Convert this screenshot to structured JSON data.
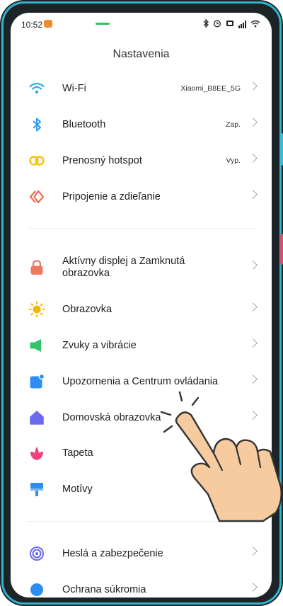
{
  "status_bar": {
    "time": "10:52",
    "icons": [
      "bluetooth-icon",
      "alarm-icon",
      "battery-saver-icon",
      "signal-icon",
      "wifi-icon"
    ]
  },
  "header": {
    "title": "Nastavenia"
  },
  "sections": [
    {
      "items": [
        {
          "label": "Wi-Fi",
          "value": "Xiaomi_B8EE_5G",
          "icon": "wifi-icon",
          "color": "#2fb0e0"
        },
        {
          "label": "Bluetooth",
          "value": "Zap.",
          "icon": "bluetooth-icon",
          "color": "#2d9cf0"
        },
        {
          "label": "Prenosný hotspot",
          "value": "Vyp.",
          "icon": "hotspot-icon",
          "color": "#f2c500"
        },
        {
          "label": "Pripojenie a zdieľanie",
          "value": "",
          "icon": "connection-sharing-icon",
          "color": "#ef6a4f"
        }
      ]
    },
    {
      "items": [
        {
          "label": "Aktívny displej a Zamknutá obrazovka",
          "value": "",
          "icon": "lock-icon",
          "color": "#f07860"
        },
        {
          "label": "Obrazovka",
          "value": "",
          "icon": "sun-icon",
          "color": "#f6b400"
        },
        {
          "label": "Zvuky a vibrácie",
          "value": "",
          "icon": "speaker-icon",
          "color": "#2fc46c"
        },
        {
          "label": "Upozornenia a Centrum ovládania",
          "value": "",
          "icon": "notifications-icon",
          "color": "#2b8cf4"
        },
        {
          "label": "Domovská obrazovka",
          "value": "",
          "icon": "home-icon",
          "color": "#6a69f0"
        },
        {
          "label": "Tapeta",
          "value": "",
          "icon": "flower-icon",
          "color": "#f0457a"
        },
        {
          "label": "Motívy",
          "value": "",
          "icon": "paint-roller-icon",
          "color": "#2d8ef0"
        }
      ]
    },
    {
      "items": [
        {
          "label": "Heslá a zabezpečenie",
          "value": "",
          "icon": "fingerprint-icon",
          "color": "#6a69f0"
        },
        {
          "label": "Ochrana súkromia",
          "value": "",
          "icon": "privacy-icon",
          "color": "#2b8cf4"
        }
      ]
    }
  ],
  "colors": {
    "frame": "#1d2428",
    "frame_accent": "#2fb3cf",
    "chevron": "#a7a7a7",
    "hand": "#f7cba0"
  }
}
